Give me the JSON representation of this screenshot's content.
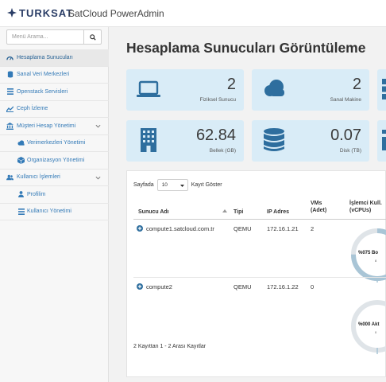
{
  "header": {
    "brand": "TURKSAT",
    "app_title": "SatCloud PowerAdmin",
    "brand_color": "#2a3d66"
  },
  "sidebar": {
    "search_placeholder": "Menü Arama...",
    "items": [
      {
        "label": "Hesaplama Sunucuları",
        "icon": "dashboard-icon",
        "active": true
      },
      {
        "label": "Sanal Veri Merkezleri",
        "icon": "database-icon"
      },
      {
        "label": "Openstack Servisleri",
        "icon": "list-icon"
      },
      {
        "label": "Ceph İzleme",
        "icon": "chart-icon"
      },
      {
        "label": "Müşteri Hesap Yönetimi",
        "icon": "bank-icon",
        "expandable": true
      },
      {
        "label": "Verimerkezleri Yönetimi",
        "icon": "cloud-icon",
        "sub": true
      },
      {
        "label": "Organizasyon Yönetimi",
        "icon": "cube-icon",
        "sub": true
      },
      {
        "label": "Kullanıcı İşlemleri",
        "icon": "users-icon",
        "expandable": true
      },
      {
        "label": "Profilim",
        "icon": "user-icon",
        "sub": true
      },
      {
        "label": "Kullanıcı Yönetimi",
        "icon": "list-icon",
        "sub": true
      }
    ]
  },
  "main": {
    "title": "Hesaplama Sunucuları Görüntüleme",
    "cards": [
      {
        "value": "2",
        "label": "Fiziksel Sunucu",
        "icon": "laptop-icon"
      },
      {
        "value": "2",
        "label": "Sanal Makine",
        "icon": "cloud-icon"
      },
      {
        "value": "62.84",
        "label": "Bellek (GB)",
        "icon": "building-icon"
      },
      {
        "value": "0.07",
        "label": "Disk (TB)",
        "icon": "database-icon"
      }
    ],
    "card_color": "#d9ecf7",
    "icon_color": "#2e6e9e"
  },
  "table": {
    "page_size_label": "Sayfada",
    "page_size_value": "10",
    "page_size_suffix": "Kayıt Göster",
    "columns": [
      "Sunucu Adı",
      "Tipi",
      "IP Adres",
      "VMs (Adet)",
      "İşlemci Kull. (vCPUs)"
    ],
    "rows": [
      {
        "name": "compute1.satcloud.com.tr",
        "type": "QEMU",
        "ip": "172.16.1.21",
        "vms": "2",
        "cpu_label": "%075 Bo",
        "cpu_sub": "8",
        "cpu_usage": 0.75
      },
      {
        "name": "compute2",
        "type": "QEMU",
        "ip": "172.16.1.22",
        "vms": "0",
        "cpu_label": "%000 Akt",
        "cpu_sub": "0",
        "cpu_usage": 0.0
      }
    ],
    "footer": "2 Kayıttan 1 - 2 Arası Kayıtlar"
  }
}
